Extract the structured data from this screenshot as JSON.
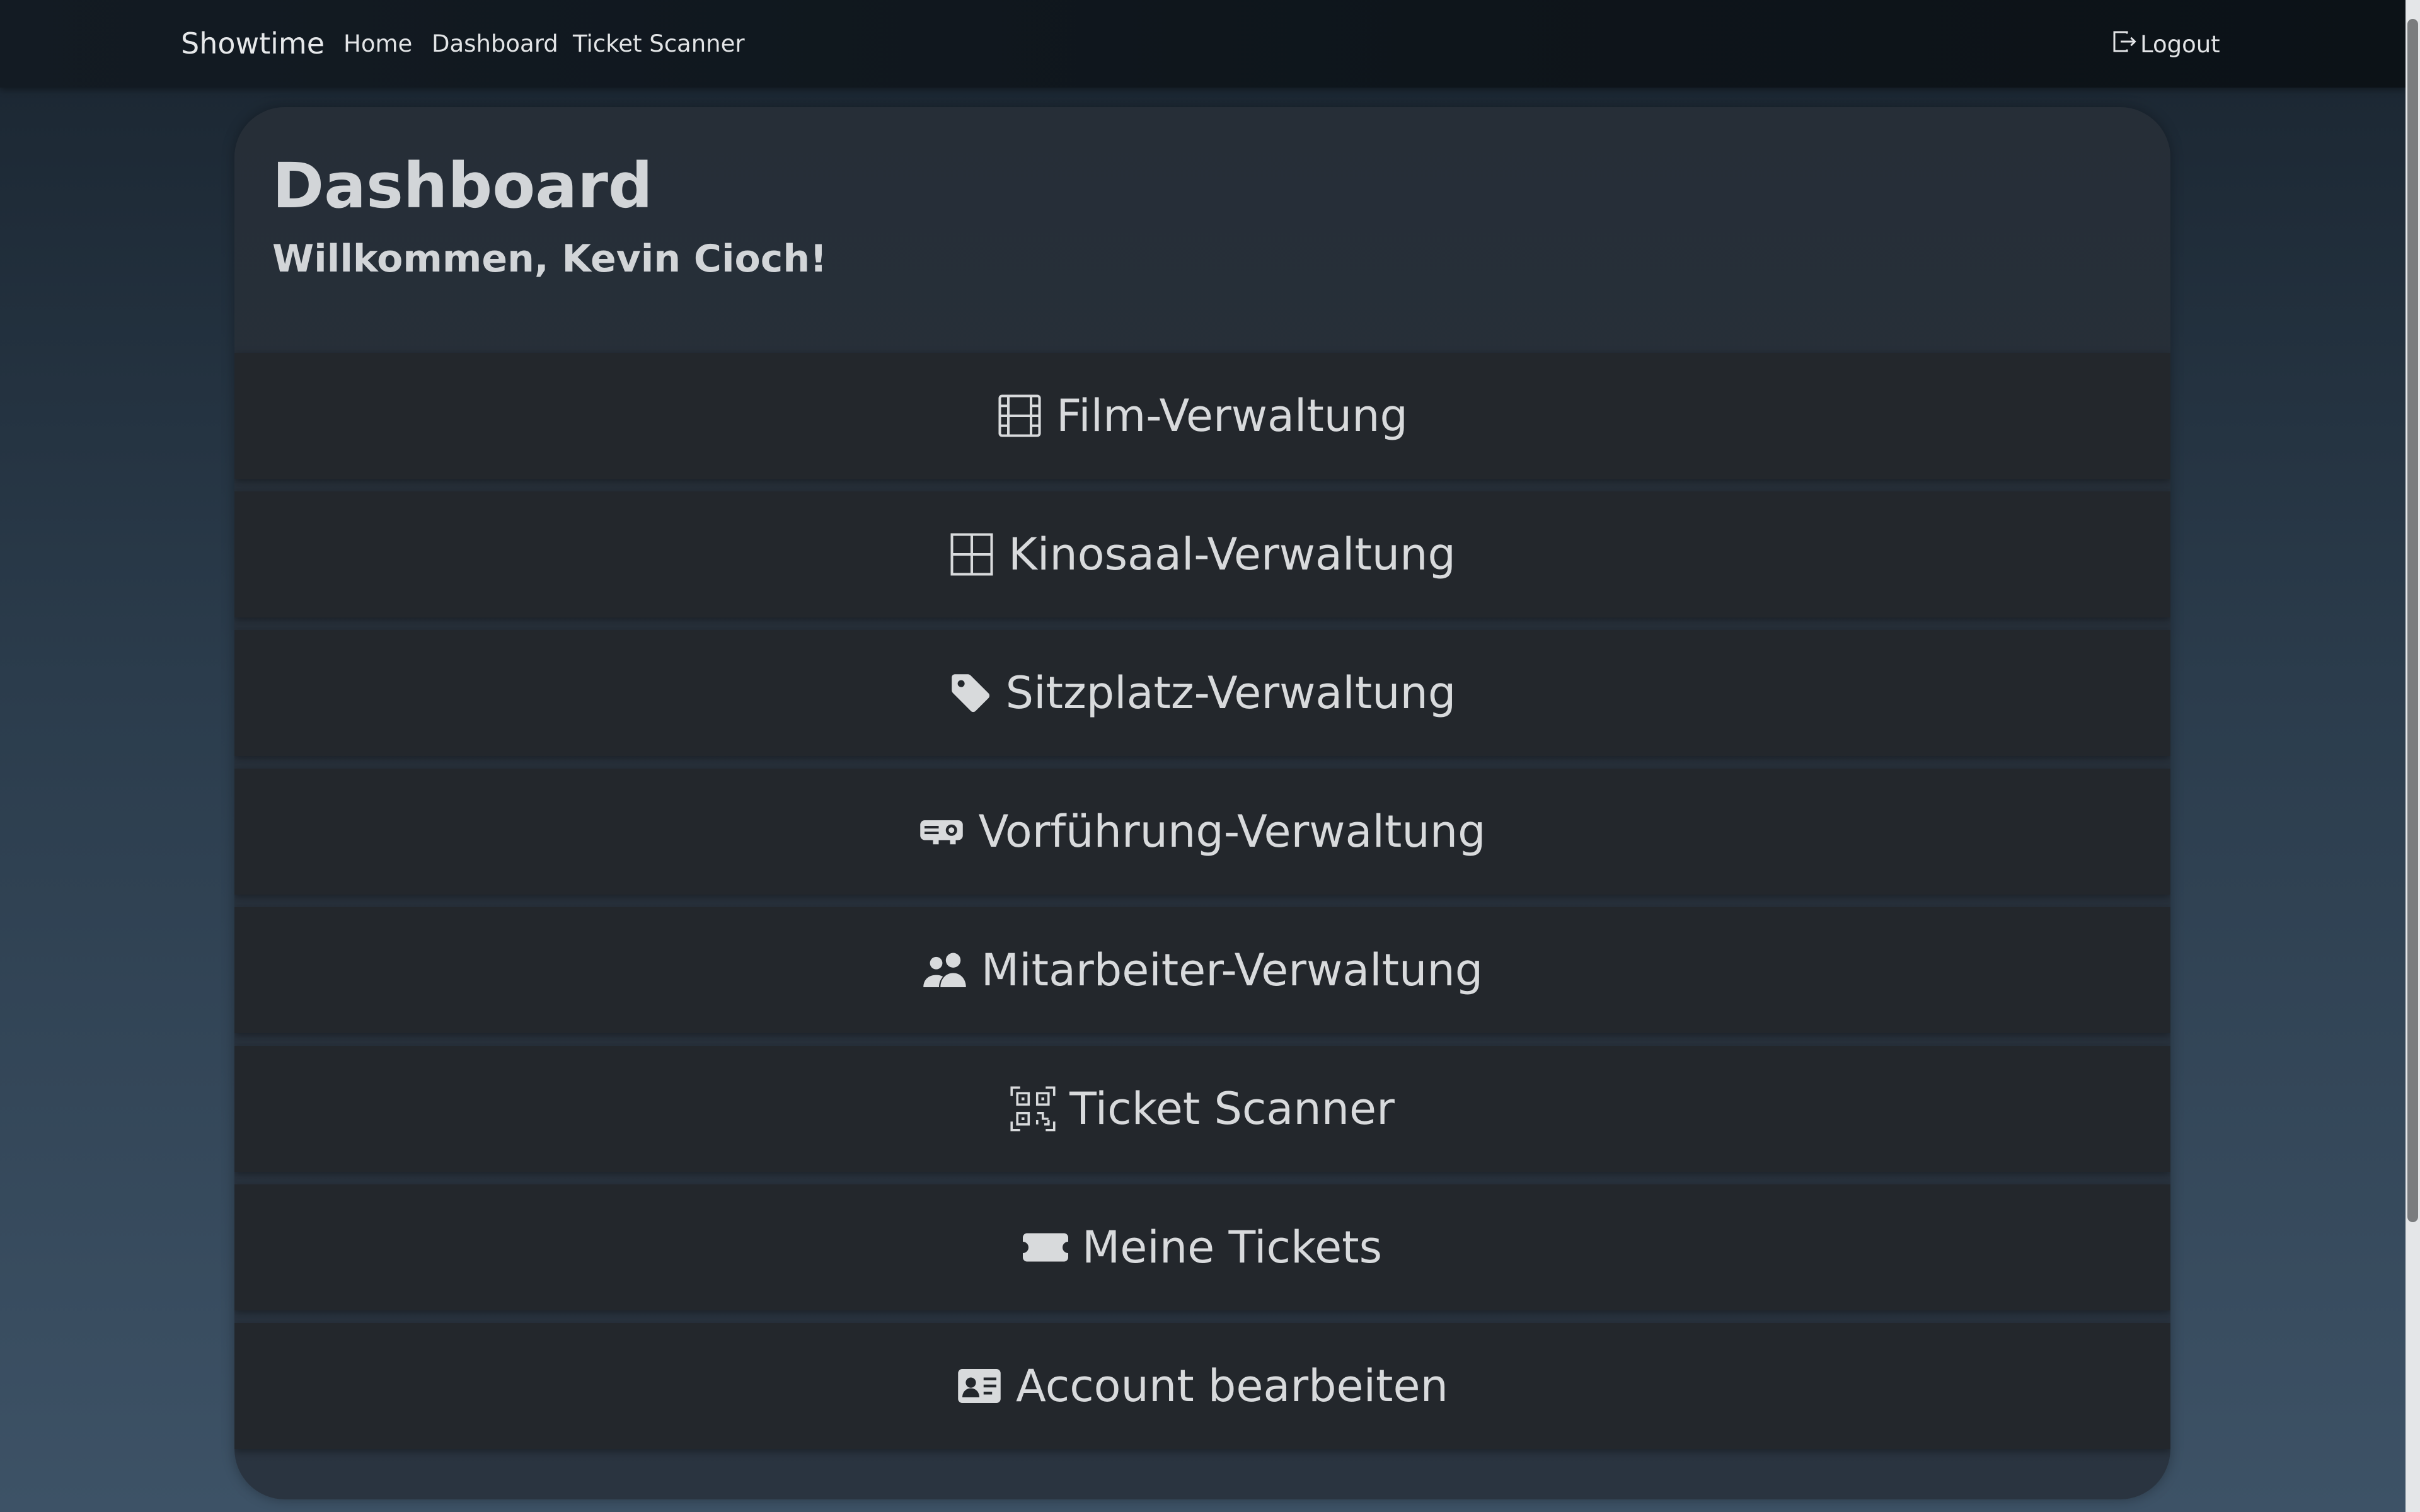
{
  "navbar": {
    "brand": "Showtime",
    "links": [
      {
        "label": "Home"
      },
      {
        "label": "Dashboard"
      },
      {
        "label": "Ticket Scanner"
      }
    ],
    "logout_label": "Logout"
  },
  "main": {
    "title": "Dashboard",
    "welcome": "Willkommen, Kevin Cioch!",
    "menu": [
      {
        "label": "Film-Verwaltung",
        "icon": "film-icon"
      },
      {
        "label": "Kinosaal-Verwaltung",
        "icon": "grid-icon"
      },
      {
        "label": "Sitzplatz-Verwaltung",
        "icon": "tag-icon"
      },
      {
        "label": "Vorführung-Verwaltung",
        "icon": "projector-icon"
      },
      {
        "label": "Mitarbeiter-Verwaltung",
        "icon": "people-icon"
      },
      {
        "label": "Ticket Scanner",
        "icon": "qr-code-icon"
      },
      {
        "label": "Meine Tickets",
        "icon": "ticket-icon"
      },
      {
        "label": "Account bearbeiten",
        "icon": "person-card-icon"
      }
    ]
  },
  "colors": {
    "navbar_bg": "#0e151b",
    "card_bg": "#262e37",
    "button_bg": "#23272c",
    "text": "#d8dadc"
  }
}
